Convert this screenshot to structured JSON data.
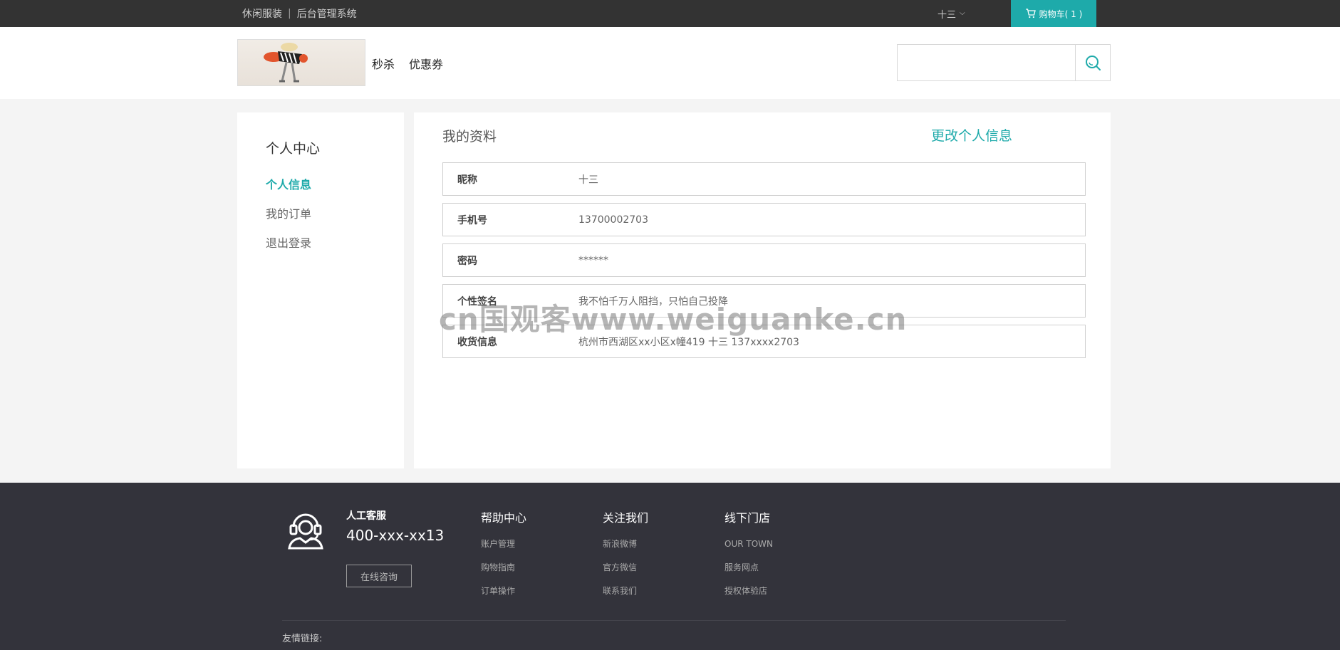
{
  "topbar": {
    "brand": "休闲服装",
    "system": "后台管理系统",
    "username": "十三",
    "cart_label": "购物车( 1 )"
  },
  "header": {
    "nav": [
      "秒杀",
      "优惠券"
    ],
    "search_placeholder": ""
  },
  "sidebar": {
    "title": "个人中心",
    "items": [
      {
        "label": "个人信息",
        "active": true
      },
      {
        "label": "我的订单",
        "active": false
      },
      {
        "label": "退出登录",
        "active": false
      }
    ]
  },
  "profile": {
    "heading": "我的资料",
    "edit_label": "更改个人信息",
    "rows": [
      {
        "label": "昵称",
        "value": "十三"
      },
      {
        "label": "手机号",
        "value": "13700002703"
      },
      {
        "label": "密码",
        "value": "******"
      },
      {
        "label": "个性签名",
        "value": "我不怕千万人阻挡，只怕自己投降"
      },
      {
        "label": "收货信息",
        "value": "杭州市西湖区xx小区x幢419 十三 137xxxx2703"
      }
    ]
  },
  "watermark": "cn国观客www.weiguanke.cn",
  "footer": {
    "service_title": "人工客服",
    "service_phone": "400-xxx-xx13",
    "consult_label": "在线咨询",
    "columns": [
      {
        "title": "帮助中心",
        "links": [
          "账户管理",
          "购物指南",
          "订单操作"
        ]
      },
      {
        "title": "关注我们",
        "links": [
          "新浪微博",
          "官方微信",
          "联系我们"
        ]
      },
      {
        "title": "线下门店",
        "links": [
          "OUR TOWN",
          "服务网点",
          "授权体验店"
        ]
      }
    ],
    "friend_links_label": "友情链接:"
  },
  "colors": {
    "accent": "#1eaaaa",
    "topbar_bg": "#333333",
    "footer_bg": "#33333b"
  }
}
